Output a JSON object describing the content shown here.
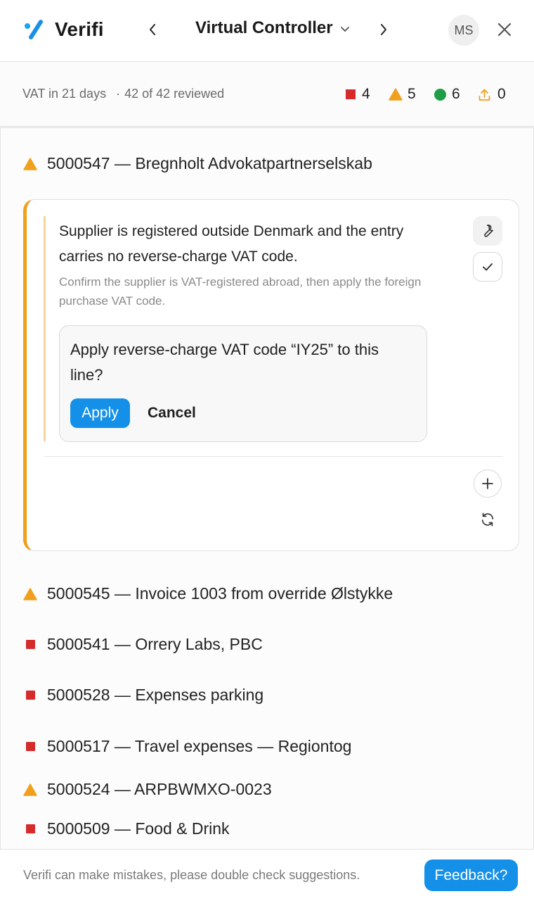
{
  "header": {
    "app_name": "Verifi",
    "title": "Virtual Controller",
    "avatar_initials": "MS",
    "brand_color": "#1590e8"
  },
  "status": {
    "vat_due": "VAT in 21 days",
    "separator": "·",
    "reviewed": "42 of 42 reviewed",
    "counts": {
      "red": "4",
      "orange": "5",
      "green": "6",
      "upload": "0"
    }
  },
  "active_item": {
    "label": "5000547 — Bregnholt Advokatpartnerselskab",
    "severity": "warning",
    "message": "Supplier is registered outside Denmark and the entry carries no reverse-charge VAT code.",
    "hint": "Confirm the supplier is VAT-registered abroad, then apply the foreign purchase VAT code.",
    "confirm_question": "Apply reverse-charge VAT code “IY25” to this line?",
    "apply_label": "Apply",
    "cancel_label": "Cancel"
  },
  "items": [
    {
      "label": "5000545 — Invoice 1003 from override Ølstykke",
      "severity": "warning"
    },
    {
      "label": "5000541 — Orrery Labs, PBC",
      "severity": "error"
    },
    {
      "label": "5000528 — Expenses parking",
      "severity": "error"
    },
    {
      "label": "5000517 — Travel expenses — Regiontog",
      "severity": "error"
    },
    {
      "label": "5000524 — ARPBWMXO-0023",
      "severity": "warning"
    },
    {
      "label": "5000509 — Food & Drink",
      "severity": "error"
    }
  ],
  "colors": {
    "error": "#d62b2b",
    "warning": "#f0a01c",
    "success": "#1e9e46",
    "upload": "#f0a01c"
  },
  "footer": {
    "disclaimer": "Verifi can make mistakes, please double check suggestions.",
    "feedback_label": "Feedback?"
  }
}
